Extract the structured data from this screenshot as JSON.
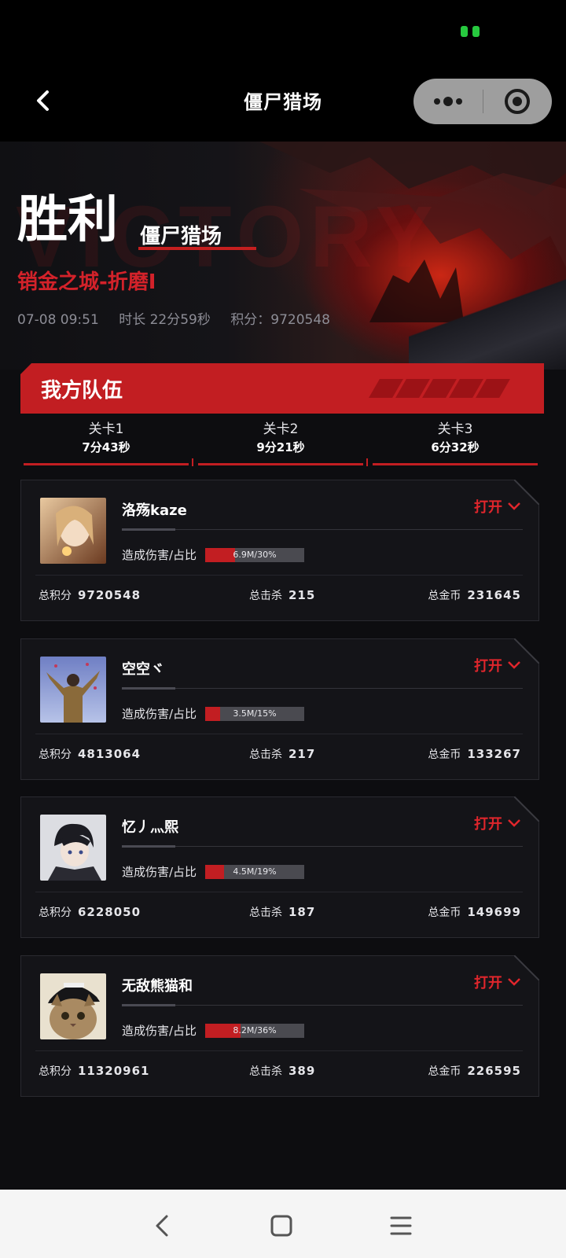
{
  "nav": {
    "title": "僵尸猎场"
  },
  "hero": {
    "result": "胜利",
    "mode": "僵尸猎场",
    "map": "销金之城-折磨I",
    "datetime": "07-08 09:51",
    "duration": "时长 22分59秒",
    "score": "积分：9720548"
  },
  "team": {
    "title": "我方队伍",
    "levels": [
      {
        "name": "关卡1",
        "time": "7分43秒"
      },
      {
        "name": "关卡2",
        "time": "9分21秒"
      },
      {
        "name": "关卡3",
        "time": "6分32秒"
      }
    ]
  },
  "labels": {
    "open": "打开",
    "damage": "造成伤害/占比",
    "total_score": "总积分",
    "total_kills": "总击杀",
    "total_gold": "总金币"
  },
  "players": [
    {
      "name": "洛殇kaze",
      "damage": "6.9M/30%",
      "damage_pct": 30,
      "score": "9720548",
      "kills": "215",
      "gold": "231645"
    },
    {
      "name": "空空ヾ",
      "damage": "3.5M/15%",
      "damage_pct": 15,
      "score": "4813064",
      "kills": "217",
      "gold": "133267"
    },
    {
      "name": "忆丿灬熙",
      "damage": "4.5M/19%",
      "damage_pct": 19,
      "score": "6228050",
      "kills": "187",
      "gold": "149699"
    },
    {
      "name": "无敌熊猫和",
      "damage": "8.2M/36%",
      "damage_pct": 36,
      "score": "11320961",
      "kills": "389",
      "gold": "226595"
    }
  ],
  "colors": {
    "accent": "#c21e22",
    "background": "#0d0d10"
  }
}
